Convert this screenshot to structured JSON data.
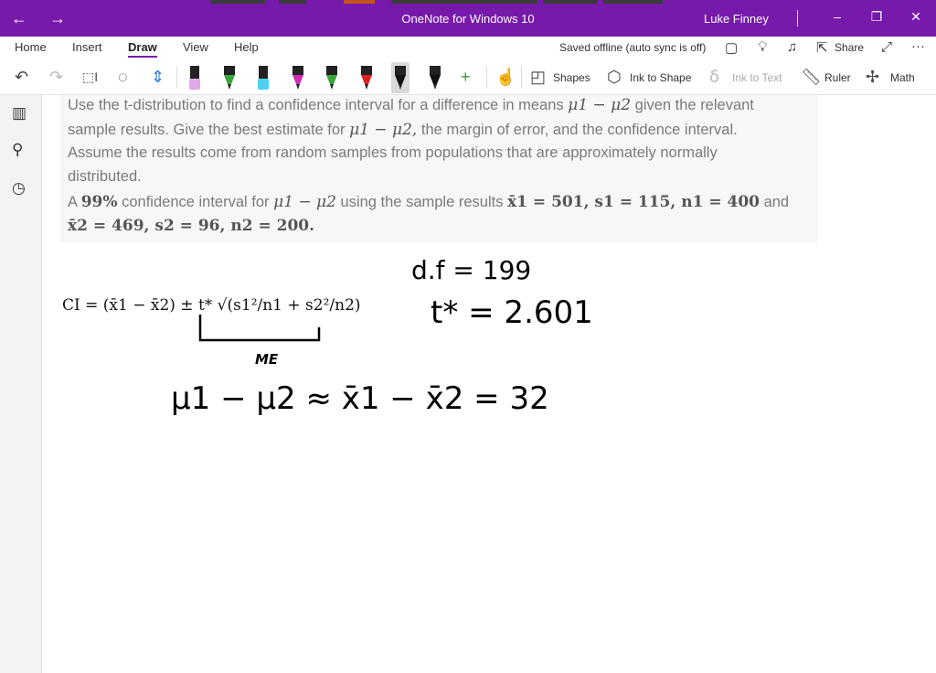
{
  "titlebar": {
    "back_glyph": "←",
    "forward_glyph": "→",
    "app_title": "OneNote for Windows 10",
    "user_name": "Luke Finney",
    "minimize_glyph": "–",
    "restore_glyph": "❐",
    "close_glyph": "✕"
  },
  "ribbon": {
    "tabs": [
      {
        "label": "Home"
      },
      {
        "label": "Insert"
      },
      {
        "label": "Draw"
      },
      {
        "label": "View"
      },
      {
        "label": "Help"
      }
    ],
    "active_tab": "Draw",
    "sync_status": "Saved offline (auto sync is off)",
    "share_label": "Share",
    "more_glyph": "···"
  },
  "toolbar": {
    "shapes_label": "Shapes",
    "ink_to_shape_label": "Ink to Shape",
    "ink_to_text_label": "Ink to Text",
    "ruler_label": "Ruler",
    "math_label": "Math",
    "pens": [
      {
        "name": "highlighter-pink",
        "color": "#e0a8e8"
      },
      {
        "name": "pen-green-1",
        "color": "#3aa53a"
      },
      {
        "name": "highlighter-cyan",
        "color": "#4fd0f0"
      },
      {
        "name": "pen-magenta",
        "color": "#d12bb0"
      },
      {
        "name": "pen-green-2",
        "color": "#3aa53a"
      },
      {
        "name": "pen-red",
        "color": "#e02020"
      },
      {
        "name": "pen-black-selected",
        "color": "#111111"
      },
      {
        "name": "pen-black",
        "color": "#111111"
      }
    ]
  },
  "sidebar": {
    "icons": [
      "notebooks-icon",
      "search-icon",
      "recent-icon"
    ]
  },
  "question": {
    "line1_pre": "Use the t-distribution to find a confidence interval for a difference in means",
    "line1_math": "μ1 − μ2",
    "line1_post": "given the relevant",
    "line2_pre": "sample results. Give the best estimate for",
    "line2_math": "μ1 − μ2,",
    "line2_post": "the margin of error, and the confidence interval.",
    "line3": "Assume the results come from random samples from populations that are approximately normally",
    "line4": "distributed.",
    "line5_pre": "A",
    "line5_pct": "99%",
    "line5_mid": "confidence interval for",
    "line5_math": "μ1 − μ2",
    "line5_mid2": "using the sample results",
    "line5_vals": "x̄1 = 501, s1 = 115, n1 = 400",
    "line5_post": "and",
    "line6_vals": "x̄2 = 469, s2 = 96, n2 = 200."
  },
  "notes": {
    "formula": "CI = (x̄1 − x̄2) ± t* √(s1²/n1 + s2²/n2)",
    "me_label": "ME",
    "df_line": "d.f = 199",
    "tstar_line": "t* = 2.601",
    "estimate_line": "μ1 − μ2 ≈ x̄1 − x̄2 = 32"
  }
}
